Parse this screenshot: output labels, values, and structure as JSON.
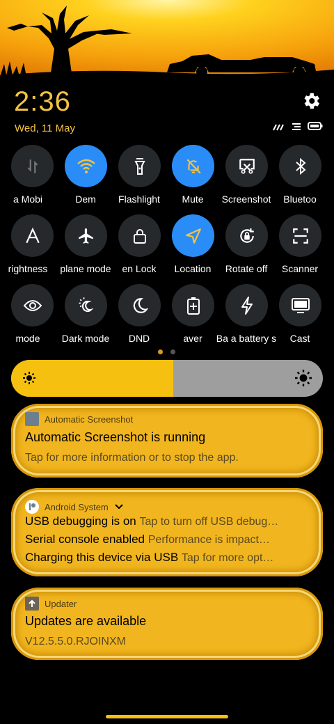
{
  "clock": {
    "time": "2:36",
    "date": "Wed, 11 May"
  },
  "tiles": [
    {
      "label": "a  Mobi",
      "icon": "mobile-data-icon",
      "active": false
    },
    {
      "label": "Dem",
      "icon": "wifi-icon",
      "active": true
    },
    {
      "label": "Flashlight",
      "icon": "flashlight-icon",
      "active": false
    },
    {
      "label": "Mute",
      "icon": "mute-bell-icon",
      "active": true
    },
    {
      "label": "Screenshot",
      "icon": "screenshot-icon",
      "active": false
    },
    {
      "label": "Bluetoo",
      "icon": "bluetooth-icon",
      "active": false
    },
    {
      "label": "rightness",
      "icon": "auto-brightness-icon",
      "active": false
    },
    {
      "label": "plane mode",
      "icon": "airplane-icon",
      "active": false
    },
    {
      "label": "en    Lock",
      "icon": "lock-icon",
      "active": false
    },
    {
      "label": "Location",
      "icon": "location-icon",
      "active": true
    },
    {
      "label": "Rotate off",
      "icon": "rotate-lock-icon",
      "active": false
    },
    {
      "label": "Scanner",
      "icon": "scanner-icon",
      "active": false
    },
    {
      "label": "mode",
      "icon": "eye-icon",
      "active": false
    },
    {
      "label": "Dark mode",
      "icon": "dark-mode-icon",
      "active": false
    },
    {
      "label": "DND",
      "icon": "moon-icon",
      "active": false
    },
    {
      "label": "aver",
      "icon": "battery-saver-icon",
      "active": false
    },
    {
      "label": "Ba  a battery s",
      "icon": "ultra-battery-icon",
      "active": false
    },
    {
      "label": "Cast",
      "icon": "cast-icon",
      "active": false
    }
  ],
  "brightness": {
    "level": 0.52
  },
  "notifications": {
    "n1": {
      "app": "Automatic Screenshot",
      "title": "Automatic Screenshot is running",
      "text": "Tap for more information or to stop the app."
    },
    "n2": {
      "app": "Android System",
      "l1_title": "USB debugging is on",
      "l1_text": "Tap to turn off USB debug…",
      "l2_title": "Serial console enabled",
      "l2_text": "Performance is impact…",
      "l3_title": "Charging this device via USB",
      "l3_text": "Tap for more opt…"
    },
    "n3": {
      "app": "Updater",
      "title": "Updates are available",
      "text": "V12.5.5.0.RJOINXM"
    }
  },
  "colors": {
    "accent": "#2a8df7",
    "gold": "#f1b51f",
    "clock": "#f5c342"
  }
}
